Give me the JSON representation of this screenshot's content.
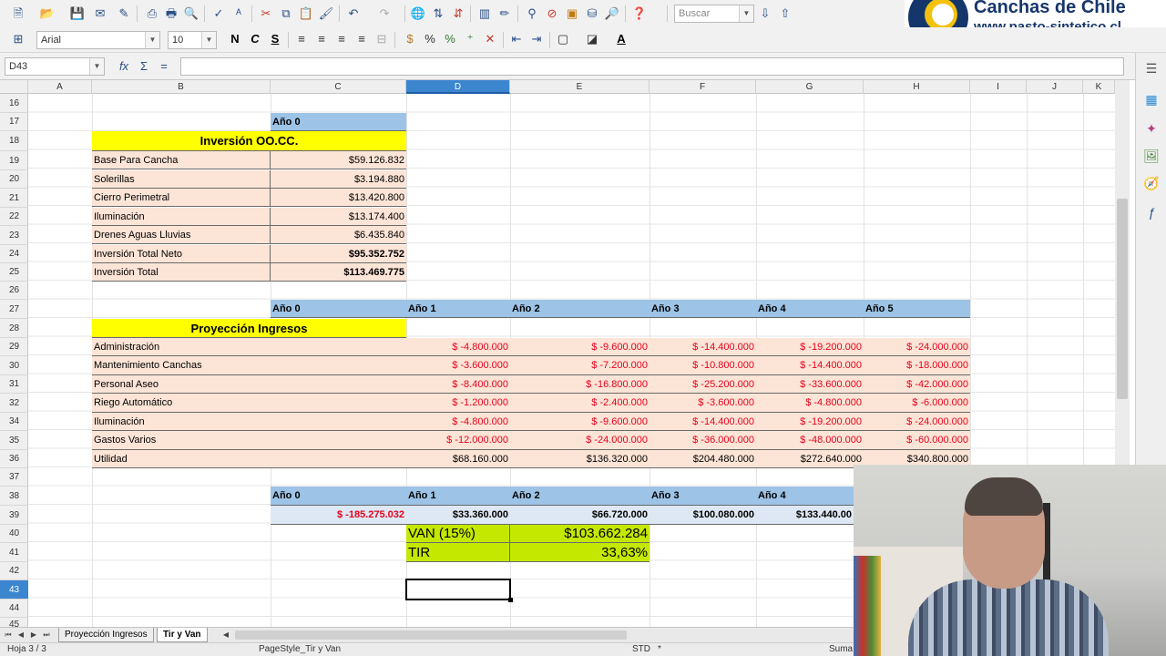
{
  "colors": {
    "pink": "#fce4d6",
    "blue": "#9dc3e6",
    "light_blue": "#dde8f4",
    "yellow": "#ffff00",
    "lime": "#c5e800",
    "negative": "#e8001c",
    "selection": "#3c86d0"
  },
  "toolbar": {
    "search_placeholder": "Buscar",
    "font_name": "Arial",
    "font_size": "10",
    "bold_label": "N",
    "italic_label": "C",
    "underline_label": "S"
  },
  "logo": {
    "title": "Canchas de Chile",
    "url": "www.pasto-sintetico.cl"
  },
  "formula_bar": {
    "cell_ref": "D43",
    "formula": "",
    "fx": "fx",
    "sigma": "Σ",
    "equals": "="
  },
  "columns": [
    "A",
    "B",
    "C",
    "D",
    "E",
    "F",
    "G",
    "H",
    "I",
    "J",
    "K"
  ],
  "rows": [
    "16",
    "17",
    "18",
    "19",
    "20",
    "21",
    "22",
    "23",
    "24",
    "25",
    "26",
    "27",
    "28",
    "29",
    "30",
    "31",
    "32",
    "34",
    "35",
    "36",
    "37",
    "38",
    "39",
    "40",
    "41",
    "42",
    "43",
    "44",
    "45"
  ],
  "investment": {
    "year_header": "Año 0",
    "title": "Inversión OO.CC.",
    "items": [
      {
        "label": "Base Para Cancha",
        "value": "$59.126.832"
      },
      {
        "label": "Solerillas",
        "value": "$3.194.880"
      },
      {
        "label": "Cierro Perimetral",
        "value": "$13.420.800"
      },
      {
        "label": "Iluminación",
        "value": "$13.174.400"
      },
      {
        "label": "Drenes Aguas Lluvias",
        "value": "$6.435.840"
      },
      {
        "label": "Inversión Total Neto",
        "value": "$95.352.752"
      },
      {
        "label": "Inversión Total",
        "value": "$113.469.775"
      }
    ]
  },
  "projection": {
    "year_headers": [
      "Año 0",
      "Año 1",
      "Año 2",
      "Año 3",
      "Año 4",
      "Año 5"
    ],
    "title": "Proyección Ingresos",
    "rows": [
      {
        "label": "Administración",
        "values": [
          "$ -4.800.000",
          "$ -9.600.000",
          "$ -14.400.000",
          "$ -19.200.000",
          "$ -24.000.000"
        ]
      },
      {
        "label": "Mantenimiento Canchas",
        "values": [
          "$ -3.600.000",
          "$ -7.200.000",
          "$ -10.800.000",
          "$ -14.400.000",
          "$ -18.000.000"
        ]
      },
      {
        "label": "Personal Aseo",
        "values": [
          "$ -8.400.000",
          "$ -16.800.000",
          "$ -25.200.000",
          "$ -33.600.000",
          "$ -42.000.000"
        ]
      },
      {
        "label": "Riego Automático",
        "values": [
          "$ -1.200.000",
          "$ -2.400.000",
          "$ -3.600.000",
          "$ -4.800.000",
          "$ -6.000.000"
        ]
      },
      {
        "label": "Iluminación",
        "values": [
          "$ -4.800.000",
          "$ -9.600.000",
          "$ -14.400.000",
          "$ -19.200.000",
          "$ -24.000.000"
        ]
      },
      {
        "label": "Gastos Varios",
        "values": [
          "$ -12.000.000",
          "$ -24.000.000",
          "$ -36.000.000",
          "$ -48.000.000",
          "$ -60.000.000"
        ]
      },
      {
        "label": "Utilidad",
        "values": [
          "$68.160.000",
          "$136.320.000",
          "$204.480.000",
          "$272.640.000",
          "$340.800.000"
        ]
      }
    ]
  },
  "cashflow": {
    "year_headers": [
      "Año 0",
      "Año 1",
      "Año 2",
      "Año 3",
      "Año 4"
    ],
    "values": [
      "$ -185.275.032",
      "$33.360.000",
      "$66.720.000",
      "$100.080.000",
      "$133.440.00"
    ],
    "van_label": "VAN (15%)",
    "van_value": "$103.662.284",
    "tir_label": "TIR",
    "tir_value": "33,63%"
  },
  "tabs": {
    "sheet1": "Proyección Ingresos",
    "sheet2": "Tir y Van"
  },
  "status": {
    "sheet": "Hoja 3 / 3",
    "pagestyle": "PageStyle_Tir y Van",
    "mode": "STD",
    "star": "*",
    "sum": "Suma"
  }
}
